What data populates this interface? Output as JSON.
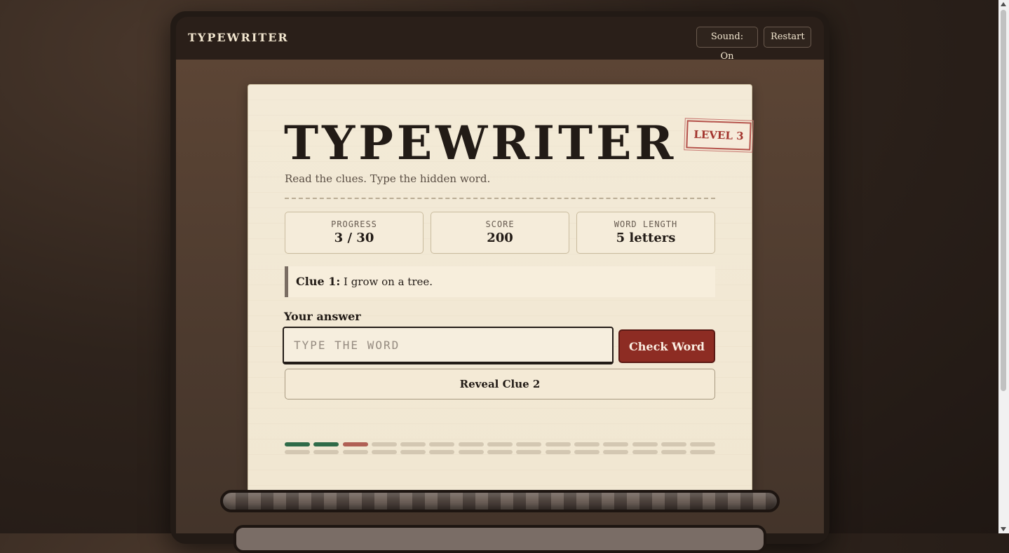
{
  "header": {
    "brand": "TYPEWRITER",
    "sound_label": "Sound: On",
    "restart_label": "Restart"
  },
  "card": {
    "title": "TYPEWRITER",
    "level_stamp": "LEVEL 3",
    "subtitle": "Read the clues. Type the hidden word."
  },
  "stats": [
    {
      "label": "PROGRESS",
      "value": "3 / 30"
    },
    {
      "label": "SCORE",
      "value": "200"
    },
    {
      "label": "WORD LENGTH",
      "value": "5 letters"
    }
  ],
  "clue": {
    "label": "Clue 1:",
    "text": "I grow on a tree."
  },
  "answer": {
    "label": "Your answer",
    "placeholder": "TYPE THE WORD",
    "value": ""
  },
  "buttons": {
    "check": "Check Word",
    "reveal": "Reveal Clue 2"
  },
  "progress_track": {
    "total": 30,
    "results": [
      "correct",
      "correct",
      "wrong"
    ]
  },
  "colors": {
    "accent": "#8d2c23",
    "correct": "#2f6b48",
    "wrong": "#b06055",
    "pending": "#d3c7b2"
  }
}
